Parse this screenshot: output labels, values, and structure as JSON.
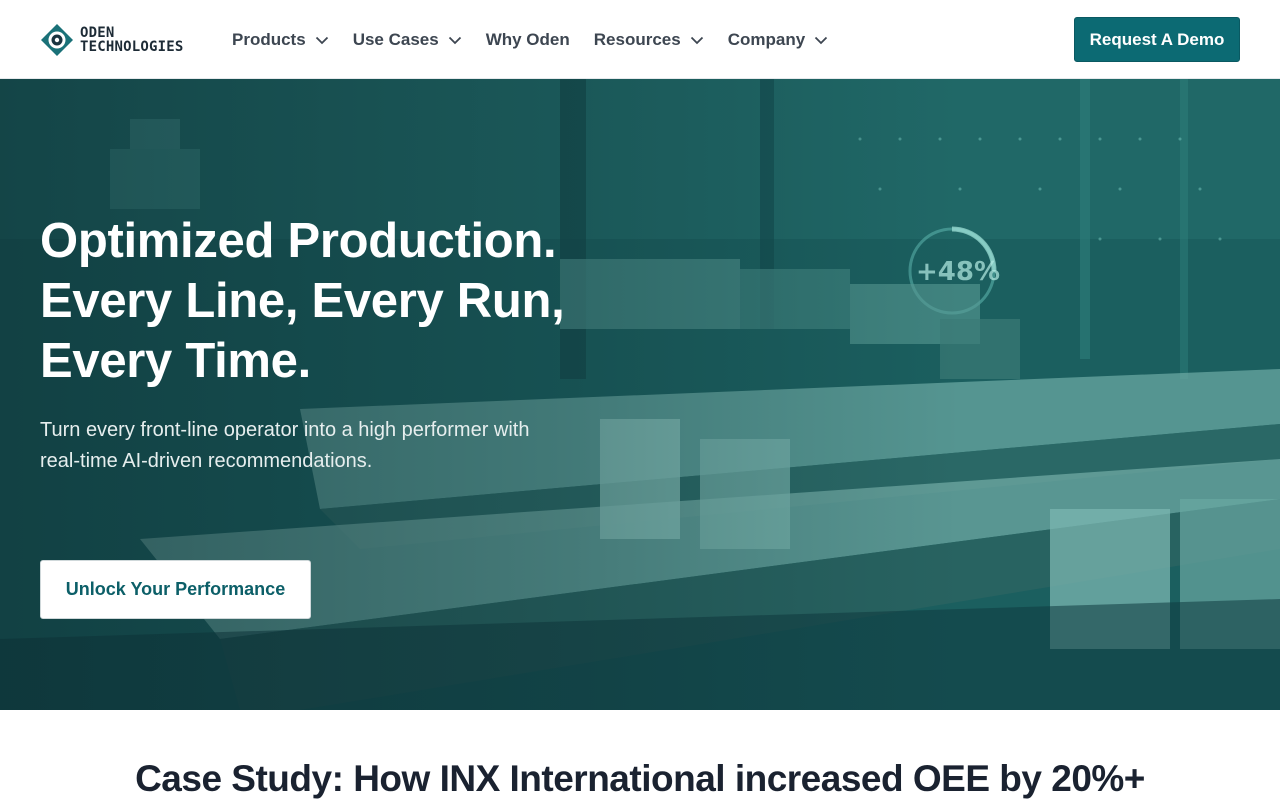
{
  "header": {
    "logo": {
      "line1": "ODEN",
      "line2": "TECHNOLOGIES"
    },
    "nav": [
      {
        "label": "Products",
        "has_dropdown": true
      },
      {
        "label": "Use Cases",
        "has_dropdown": true
      },
      {
        "label": "Why Oden",
        "has_dropdown": false
      },
      {
        "label": "Resources",
        "has_dropdown": true
      },
      {
        "label": "Company",
        "has_dropdown": true
      }
    ],
    "cta_label": "Request A Demo"
  },
  "hero": {
    "title_lines": [
      "Optimized Production.",
      "Every Line, Every Run,",
      "Every Time."
    ],
    "subtitle_lines": [
      "Turn every front-line operator into a high performer with",
      "real-time AI-driven recommendations."
    ],
    "cta_label": "Unlock Your Performance",
    "gauge_readout": "+48%"
  },
  "case_study": {
    "title": "Case Study: How INX International increased OEE by 20%+"
  },
  "colors": {
    "brand_teal": "#0c6a73",
    "hero_tint": "#1d6664",
    "text_dark": "#1a2230"
  },
  "icons": {
    "logo": "eye-icon",
    "dropdown": "chevron-down-icon"
  }
}
